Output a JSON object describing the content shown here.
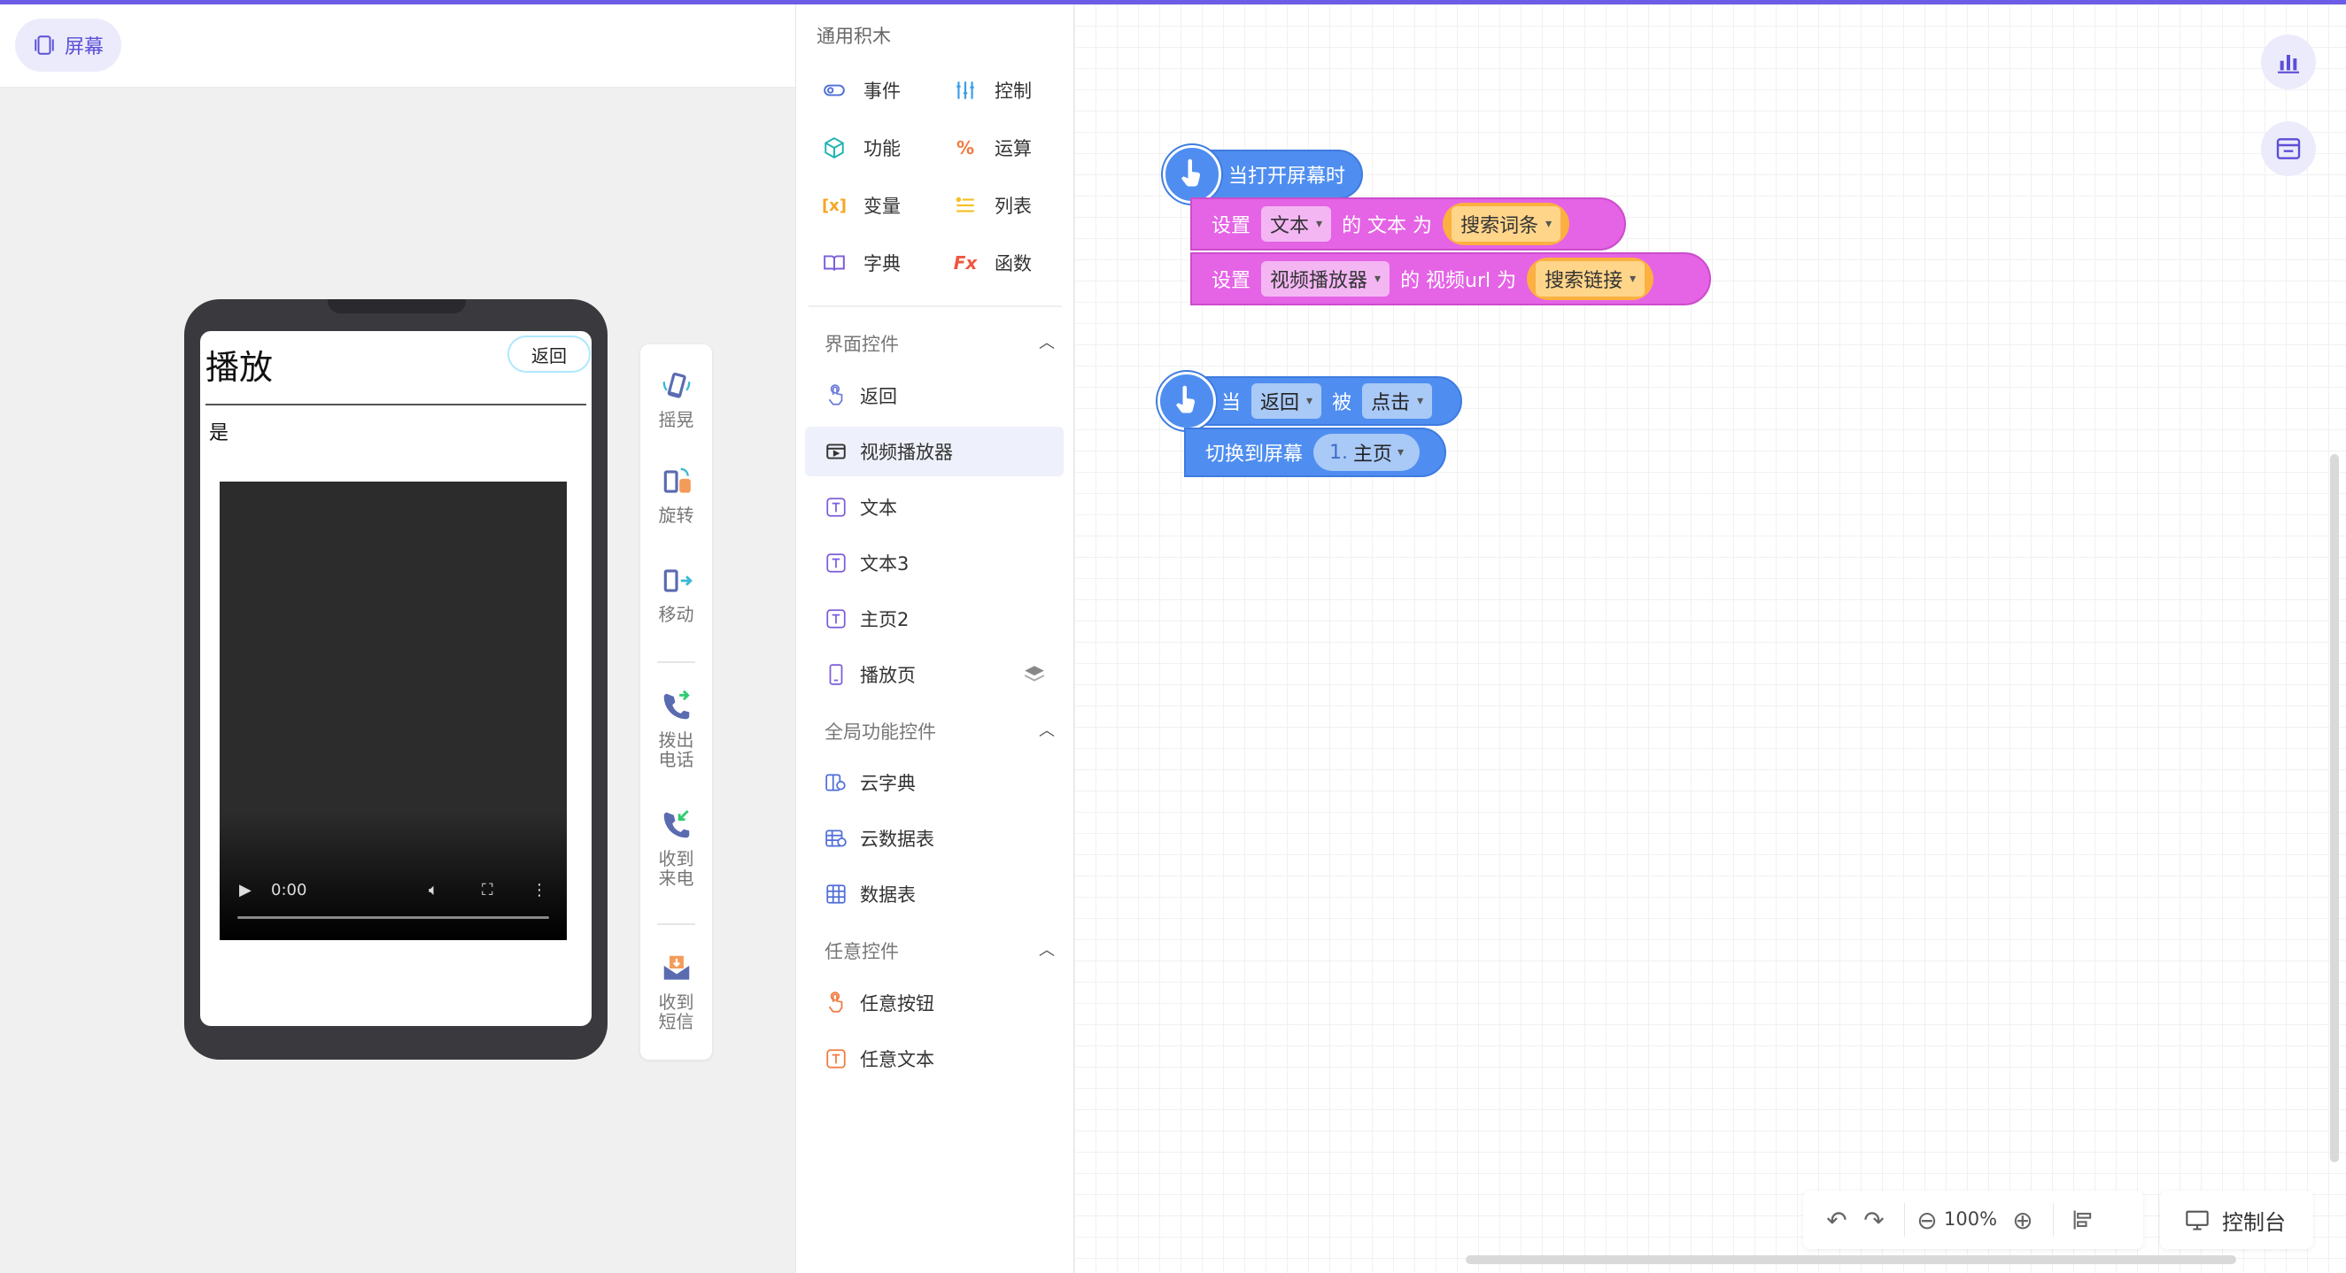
{
  "left": {
    "screen_chip": "屏幕",
    "phone": {
      "title": "播放",
      "back_button": "返回",
      "text": "是",
      "video_time": "0:00"
    },
    "sensors": [
      "摇晃",
      "旋转",
      "移动",
      "拨出\n电话",
      "收到\n来电",
      "收到\n短信"
    ]
  },
  "palette": {
    "general_title": "通用积木",
    "categories": [
      {
        "label": "事件",
        "icon": "toggle-icon",
        "color": "#4f6ed8"
      },
      {
        "label": "控制",
        "icon": "sliders-icon",
        "color": "#3a9de8"
      },
      {
        "label": "功能",
        "icon": "cube-icon",
        "color": "#1fb3b3"
      },
      {
        "label": "运算",
        "icon": "percent-icon",
        "color": "#f07a3e"
      },
      {
        "label": "变量",
        "icon": "variable-icon",
        "color": "#f5a623"
      },
      {
        "label": "列表",
        "icon": "list-icon",
        "color": "#f5c023"
      },
      {
        "label": "字典",
        "icon": "book-icon",
        "color": "#7b5cd9"
      },
      {
        "label": "函数",
        "icon": "fx-icon",
        "color": "#f0563e"
      }
    ],
    "sections": [
      {
        "title": "界面控件",
        "items": [
          {
            "label": "返回",
            "icon": "button-icon",
            "color": "#6c7bd8"
          },
          {
            "label": "视频播放器",
            "icon": "video-icon",
            "color": "#333333"
          },
          {
            "label": "文本",
            "icon": "text-icon",
            "color": "#7b5cd9"
          },
          {
            "label": "文本3",
            "icon": "text-icon",
            "color": "#7b5cd9"
          },
          {
            "label": "主页2",
            "icon": "text-icon",
            "color": "#7b5cd9"
          },
          {
            "label": "播放页",
            "icon": "phone-icon",
            "color": "#7b5cd9"
          }
        ]
      },
      {
        "title": "全局功能控件",
        "items": [
          {
            "label": "云字典",
            "icon": "cloud-dict-icon",
            "color": "#4f6ed8"
          },
          {
            "label": "云数据表",
            "icon": "cloud-table-icon",
            "color": "#4f6ed8"
          },
          {
            "label": "数据表",
            "icon": "table-icon",
            "color": "#4f6ed8"
          }
        ]
      },
      {
        "title": "任意控件",
        "items": [
          {
            "label": "任意按钮",
            "icon": "any-button-icon",
            "color": "#f07a3e"
          },
          {
            "label": "任意文本",
            "icon": "any-text-icon",
            "color": "#f07a3e"
          }
        ]
      }
    ]
  },
  "blocks": {
    "group1": {
      "hat": "当打开屏幕时",
      "row1": {
        "set": "设置",
        "target": "文本",
        "prop": "的 文本 为",
        "value": "搜索词条"
      },
      "row2": {
        "set": "设置",
        "target": "视频播放器",
        "prop": "的 视频url 为",
        "value": "搜索链接"
      }
    },
    "group2": {
      "when": "当",
      "target": "返回",
      "by": "被",
      "event": "点击",
      "action": "切换到屏幕",
      "screen_num": "1.",
      "screen_name": "主页"
    }
  },
  "toolbar": {
    "zoom": "100%",
    "console": "控制台"
  },
  "colors": {
    "accent": "#6c5ce7",
    "event_block": "#4f8ef0",
    "set_block": "#e563e5",
    "value_pill": "#fcb040"
  }
}
